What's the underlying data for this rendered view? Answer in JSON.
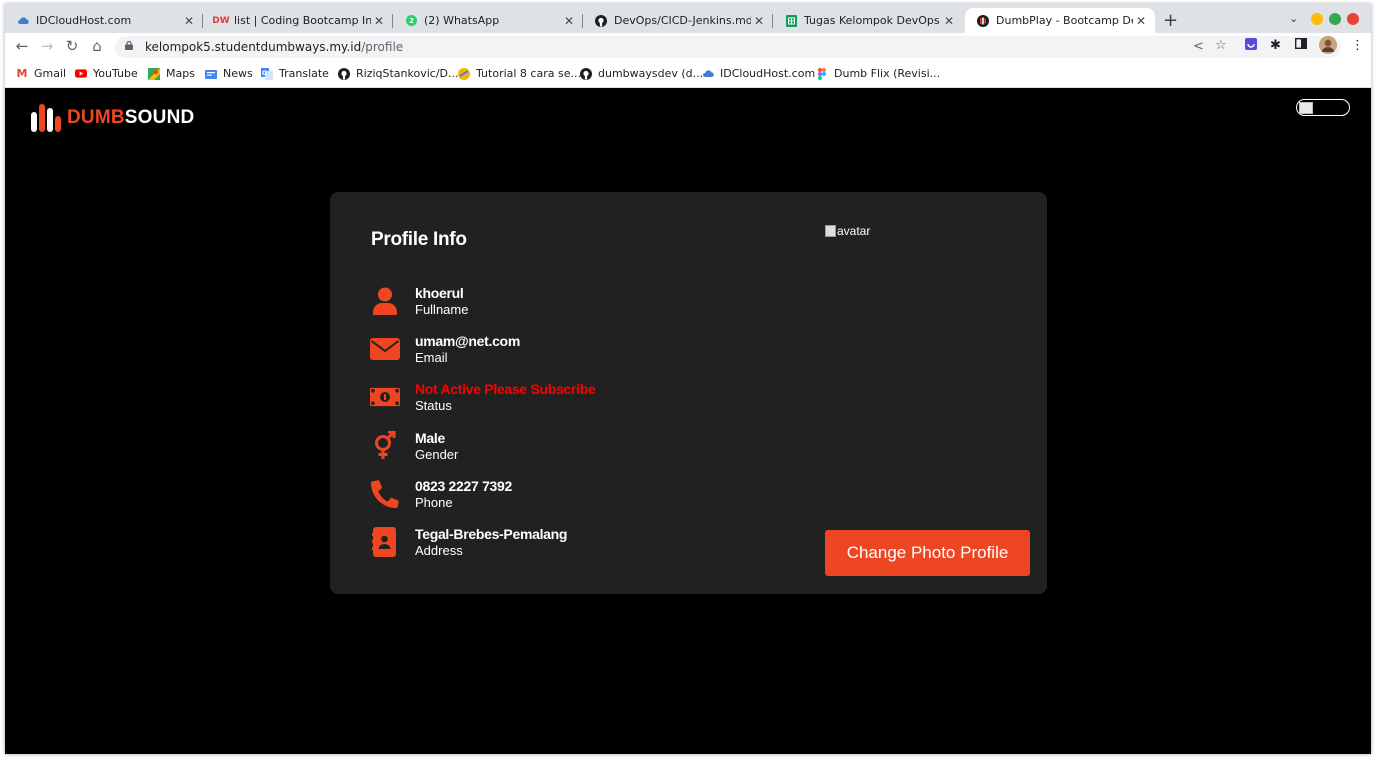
{
  "browser": {
    "tabs": [
      {
        "title": "IDCloudHost.com",
        "favicon": "cloud-icon",
        "active": false
      },
      {
        "title": "list | Coding Bootcamp Indonesia",
        "favicon": "dumbways-icon",
        "active": false
      },
      {
        "title": "(2) WhatsApp",
        "favicon": "whatsapp-icon",
        "active": false
      },
      {
        "title": "DevOps/CICD-Jenkins.md at main",
        "favicon": "github-icon",
        "active": false
      },
      {
        "title": "Tugas Kelompok DevOps Batch",
        "favicon": "sheets-icon",
        "active": false
      },
      {
        "title": "DumbPlay - Bootcamp DevOps",
        "favicon": "dumbplay-icon",
        "active": true
      }
    ],
    "url_host": "kelompok5.studentdumbways.my.id",
    "url_path": "/profile",
    "bookmarks": [
      {
        "label": "Gmail",
        "icon": "gmail-icon"
      },
      {
        "label": "YouTube",
        "icon": "youtube-icon"
      },
      {
        "label": "Maps",
        "icon": "maps-icon"
      },
      {
        "label": "News",
        "icon": "news-icon"
      },
      {
        "label": "Translate",
        "icon": "translate-icon"
      },
      {
        "label": "RiziqStankovic/D...",
        "icon": "github-icon"
      },
      {
        "label": "Tutorial 8 cara se...",
        "icon": "tutorial-icon"
      },
      {
        "label": "dumbwaysdev (d...",
        "icon": "github-icon"
      },
      {
        "label": "IDCloudHost.com",
        "icon": "cloud-icon"
      },
      {
        "label": "Dumb Flix (Revisi...",
        "icon": "figma-icon"
      }
    ],
    "colors": {
      "tabstrip": "#dee1e6",
      "traffic": [
        "#fbbc05",
        "#34a853",
        "#ea4335"
      ]
    }
  },
  "app": {
    "logo_red": "DUMB",
    "logo_white": "SOUND",
    "accent": "#ee4622"
  },
  "profile": {
    "title": "Profile Info",
    "rows": [
      {
        "icon": "user-icon",
        "value": "khoerul",
        "label": "Fullname"
      },
      {
        "icon": "mail-icon",
        "value": "umam@net.com",
        "label": "Email"
      },
      {
        "icon": "money-icon",
        "value": "Not Active Please Subscribe",
        "label": "Status"
      },
      {
        "icon": "gender-icon",
        "value": "Male",
        "label": "Gender"
      },
      {
        "icon": "phone-icon",
        "value": "0823 2227 7392",
        "label": "Phone"
      },
      {
        "icon": "address-book-icon",
        "value": "Tegal-Brebes-Pemalang",
        "label": "Address"
      }
    ],
    "avatar_alt": "avatar",
    "change_photo_label": "Change Photo Profile"
  }
}
